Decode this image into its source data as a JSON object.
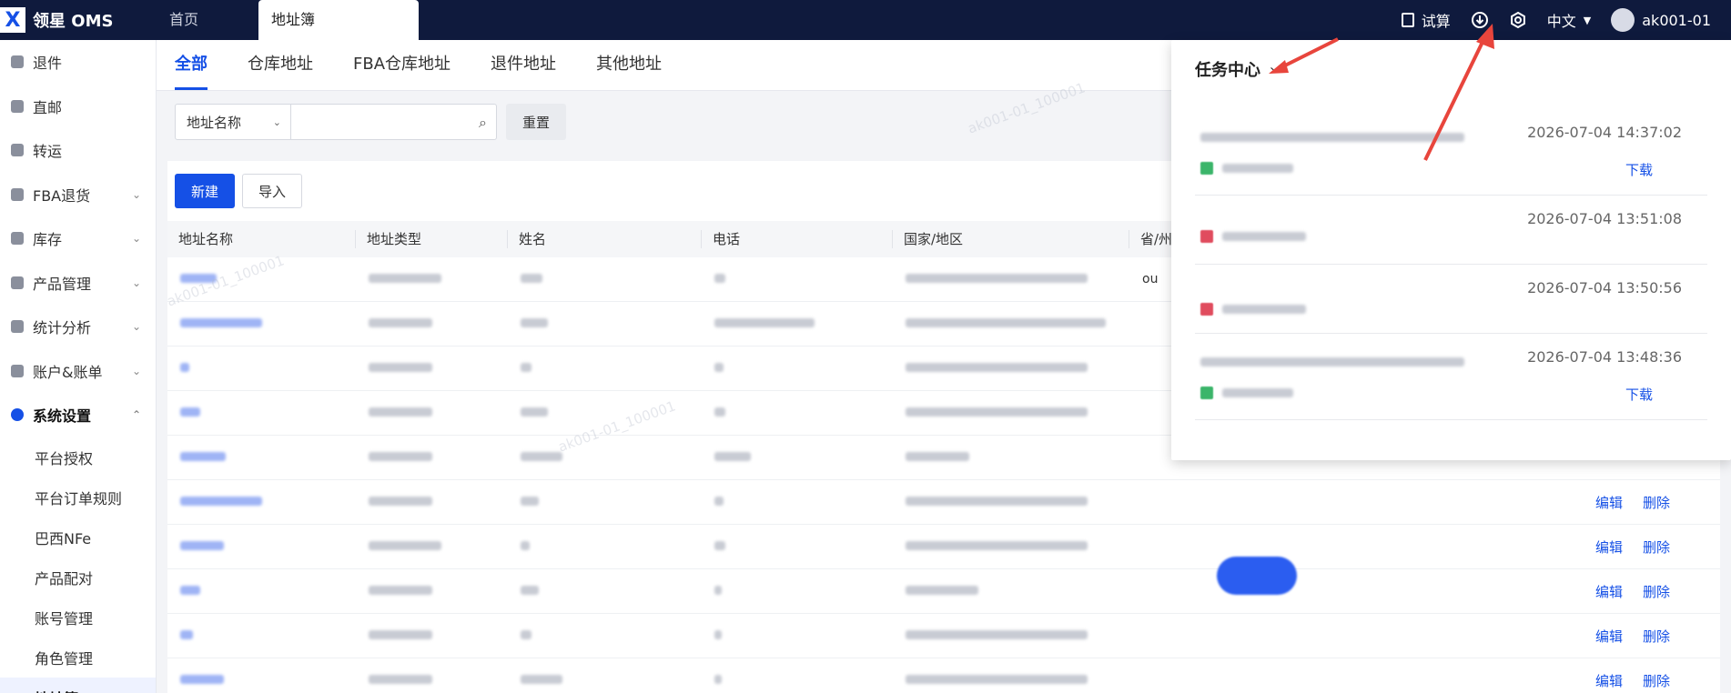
{
  "app": {
    "name": "领星 OMS",
    "logo_icon": "lingxing-logo-icon"
  },
  "top_tabs": [
    {
      "label": "首页"
    },
    {
      "label": "地址簿"
    }
  ],
  "top_right": {
    "trial": "试算",
    "language": "中文",
    "username": "ak001-01"
  },
  "sidebar": {
    "items": [
      {
        "label": "退件",
        "icon": "return-icon"
      },
      {
        "label": "直邮",
        "icon": "mail-icon"
      },
      {
        "label": "转运",
        "icon": "transfer-icon"
      },
      {
        "label": "FBA退货",
        "icon": "fba-icon"
      },
      {
        "label": "库存",
        "icon": "warehouse-icon"
      },
      {
        "label": "产品管理",
        "icon": "product-icon"
      },
      {
        "label": "统计分析",
        "icon": "chart-icon"
      },
      {
        "label": "账户&账单",
        "icon": "bill-icon"
      },
      {
        "label": "系统设置",
        "icon": "settings-icon"
      }
    ],
    "sub_items": [
      {
        "label": "平台授权"
      },
      {
        "label": "平台订单规则"
      },
      {
        "label": "巴西NFe"
      },
      {
        "label": "产品配对"
      },
      {
        "label": "账号管理"
      },
      {
        "label": "角色管理"
      },
      {
        "label": "地址簿"
      }
    ]
  },
  "sub_tabs": [
    {
      "label": "全部"
    },
    {
      "label": "仓库地址"
    },
    {
      "label": "FBA仓库地址"
    },
    {
      "label": "退件地址"
    },
    {
      "label": "其他地址"
    }
  ],
  "filter": {
    "field_label": "地址名称",
    "search_value": "",
    "reset_label": "重置"
  },
  "toolbar": {
    "new_label": "新建",
    "import_label": "导入"
  },
  "table": {
    "columns": [
      "地址名称",
      "地址类型",
      "姓名",
      "电话",
      "国家/地区",
      "省/州"
    ],
    "row_actions": {
      "edit": "编辑",
      "delete": "删除"
    },
    "visible_cells": {
      "row1_province_fragment": "ou"
    }
  },
  "task_center": {
    "title": "任务中心",
    "tasks": [
      {
        "time": "2026-07-04 14:37:02",
        "status": "ok",
        "download": "下载"
      },
      {
        "time": "2026-07-04 13:51:08",
        "status": "err",
        "download": ""
      },
      {
        "time": "2026-07-04 13:50:56",
        "status": "err",
        "download": ""
      },
      {
        "time": "2026-07-04 13:48:36",
        "status": "ok",
        "download": "下载"
      }
    ]
  },
  "colors": {
    "primary": "#1550e6",
    "topbar": "#0f1a3d",
    "arrow": "#e8453c"
  }
}
